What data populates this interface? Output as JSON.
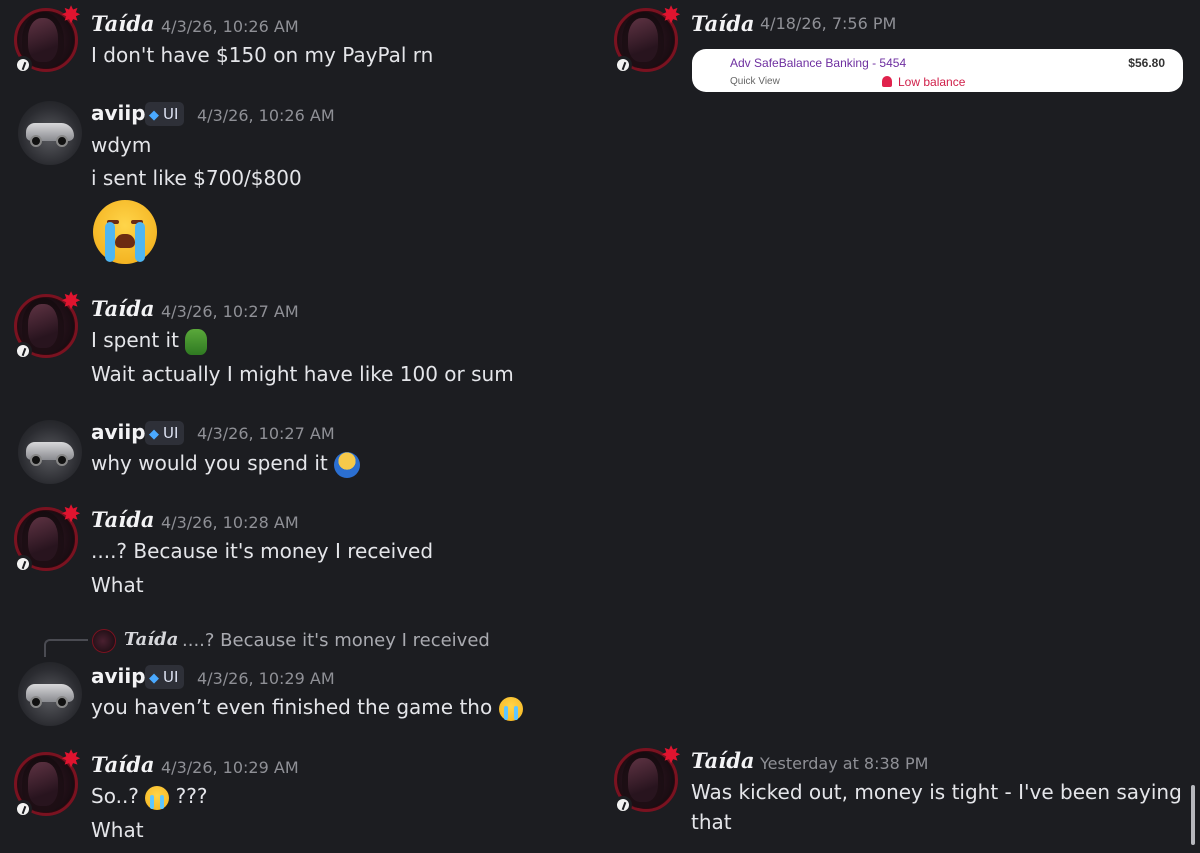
{
  "colors": {
    "background": "#1c1d21",
    "text": "#e4e5e9",
    "timestamp": "#8f9096",
    "badge_bg": "#2e3038",
    "taida_ring": "#7a1220",
    "quickview_title": "#6e2fa0",
    "low_balance": "#d0204a"
  },
  "messages": [
    {
      "author": "Taída",
      "time": "4/3/26, 10:26 AM",
      "lines": [
        "I don't have $150 on my PayPal rn"
      ]
    },
    {
      "author": "aviip",
      "badge": "UI",
      "time": "4/3/26, 10:26 AM",
      "lines": [
        "wdym",
        "i sent like $700/$800"
      ],
      "emoji_icon": "loudly-crying-face-icon"
    },
    {
      "author": "Taída",
      "time": "4/3/26, 10:27 AM",
      "lines": [
        "I spent it",
        "Wait actually I might have like 100 or sum"
      ],
      "emoji_icon": "pepe-frog-icon"
    },
    {
      "author": "aviip",
      "badge": "UI",
      "time": "4/3/26, 10:27 AM",
      "lines": [
        "why would you spend it"
      ],
      "emoji_icon": "facepalm-icon"
    },
    {
      "author": "Taída",
      "time": "4/3/26, 10:28 AM",
      "lines": [
        "....? Because it's money I received",
        "What"
      ]
    },
    {
      "author": "aviip",
      "badge": "UI",
      "time": "4/3/26, 10:29 AM",
      "lines": [
        "you haven’t even finished the game tho"
      ],
      "emoji_icon": "loudly-crying-face-icon",
      "reply": {
        "author": "Taída",
        "text": "....? Because it's money I received"
      }
    },
    {
      "author": "Taída",
      "time": "4/3/26, 10:29 AM",
      "lines": [
        "So..?",
        "???",
        "What"
      ],
      "emoji_icon": "loudly-crying-face-icon"
    },
    {
      "author": "Taída",
      "time": "4/18/26, 7:56 PM",
      "attachment": {
        "account": "Adv SafeBalance Banking - 5454",
        "amount": "$56.80",
        "sub": "Quick View",
        "alert": "Low balance",
        "alert_icon": "bell-icon"
      }
    },
    {
      "author": "Taída",
      "time": "Yesterday at 8:38 PM",
      "lines": [
        "Was kicked out, money is tight - I've been saying",
        "that"
      ]
    }
  ]
}
